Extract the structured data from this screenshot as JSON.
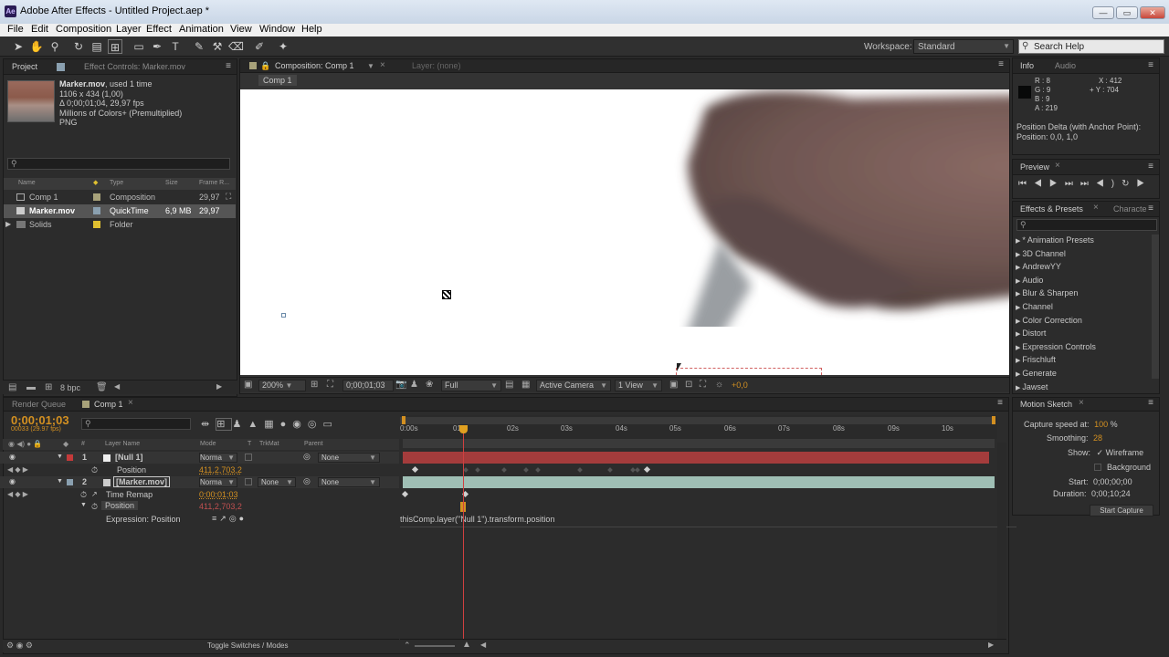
{
  "window": {
    "title": "Adobe After Effects - Untitled Project.aep *",
    "app_icon": "Ae",
    "minimize": "—",
    "maximize": "▭",
    "close": "✕"
  },
  "menu": [
    "File",
    "Edit",
    "Composition",
    "Layer",
    "Effect",
    "Animation",
    "View",
    "Window",
    "Help"
  ],
  "toolbar": {
    "workspace_label": "Workspace:",
    "workspace_value": "Standard",
    "search_placeholder": "Search Help"
  },
  "project": {
    "tabs": [
      "Project",
      "Effect Controls: Marker.mov"
    ],
    "info": {
      "name": "Marker.mov",
      "used": ", used 1 time",
      "dims": "1106 x 434 (1,00)",
      "duration": "Δ 0;00;01;04, 29,97 fps",
      "colors": "Millions of Colors+ (Premultiplied)",
      "format": "PNG"
    },
    "columns": [
      "Name",
      "Type",
      "Size",
      "Frame R..."
    ],
    "items": [
      {
        "name": "Comp 1",
        "type": "Composition",
        "size": "",
        "fps": "29,97",
        "color": "#a8a27a"
      },
      {
        "name": "Marker.mov",
        "type": "QuickTime",
        "size": "6,9 MB",
        "fps": "29,97",
        "color": "#8aa0b0"
      },
      {
        "name": "Solids",
        "type": "Folder",
        "size": "",
        "fps": "",
        "color": "#e0c030"
      }
    ],
    "bpc": "8 bpc"
  },
  "composition": {
    "tab": "Composition: Comp 1",
    "layer_tab": "Layer: (none)",
    "breadcrumb": "Comp 1",
    "zoom": "200%",
    "timecode": "0;00;01;03",
    "resolution": "Full",
    "camera": "Active Camera",
    "views": "1 View",
    "exposure": "+0,0"
  },
  "info": {
    "tabs": [
      "Info",
      "Audio"
    ],
    "r": "R : 8",
    "g": "G : 9",
    "b": "B : 9",
    "a": "A : 219",
    "x": "X : 412",
    "y": "+ Y : 704",
    "delta": "Position Delta (with Anchor Point):",
    "delta_val": "Position: 0,0, 1,0"
  },
  "preview": {
    "tab": "Preview"
  },
  "effects": {
    "tabs": [
      "Effects & Presets",
      "Characte"
    ],
    "items": [
      "* Animation Presets",
      "3D Channel",
      "AndrewYY",
      "Audio",
      "Blur & Sharpen",
      "Channel",
      "Color Correction",
      "Distort",
      "Expression Controls",
      "Frischluft",
      "Generate",
      "Jawset"
    ]
  },
  "motion_sketch": {
    "tab": "Motion Sketch",
    "capture_label": "Capture speed at:",
    "capture_val": "100",
    "capture_unit": "%",
    "smoothing_label": "Smoothing:",
    "smoothing_val": "28",
    "show_label": "Show:",
    "wireframe": "Wireframe",
    "background": "Background",
    "start_label": "Start:",
    "start_val": "0;00;00;00",
    "duration_label": "Duration:",
    "duration_val": "0;00;10;24",
    "button": "Start Capture"
  },
  "timeline": {
    "tabs": [
      "Render Queue",
      "Comp 1"
    ],
    "timecode": "0;00;01;03",
    "timecode_sub": "00033 (29.97 fps)",
    "headers": {
      "layer": "Layer Name",
      "mode": "Mode",
      "t": "T",
      "trkmat": "TrkMat",
      "parent": "Parent"
    },
    "layers": [
      {
        "num": "1",
        "name": "[Null 1]",
        "mode": "Norma",
        "parent": "None",
        "prop": "Position",
        "prop_val": "411,2,703,2"
      },
      {
        "num": "2",
        "name": "[Marker.mov]",
        "mode": "Norma",
        "trkmat": "None",
        "parent": "None",
        "prop1": "Time Remap",
        "prop1_val": "0;00;01;03",
        "prop2": "Position",
        "prop2_val": "411,2,703,2",
        "expr": "Expression: Position"
      }
    ],
    "expression": "thisComp.layer(\"Null 1\").transform.position",
    "ruler": [
      "0:00s",
      "01s",
      "02s",
      "03s",
      "04s",
      "05s",
      "06s",
      "07s",
      "08s",
      "09s",
      "10s"
    ],
    "toggle": "Toggle Switches / Modes"
  }
}
